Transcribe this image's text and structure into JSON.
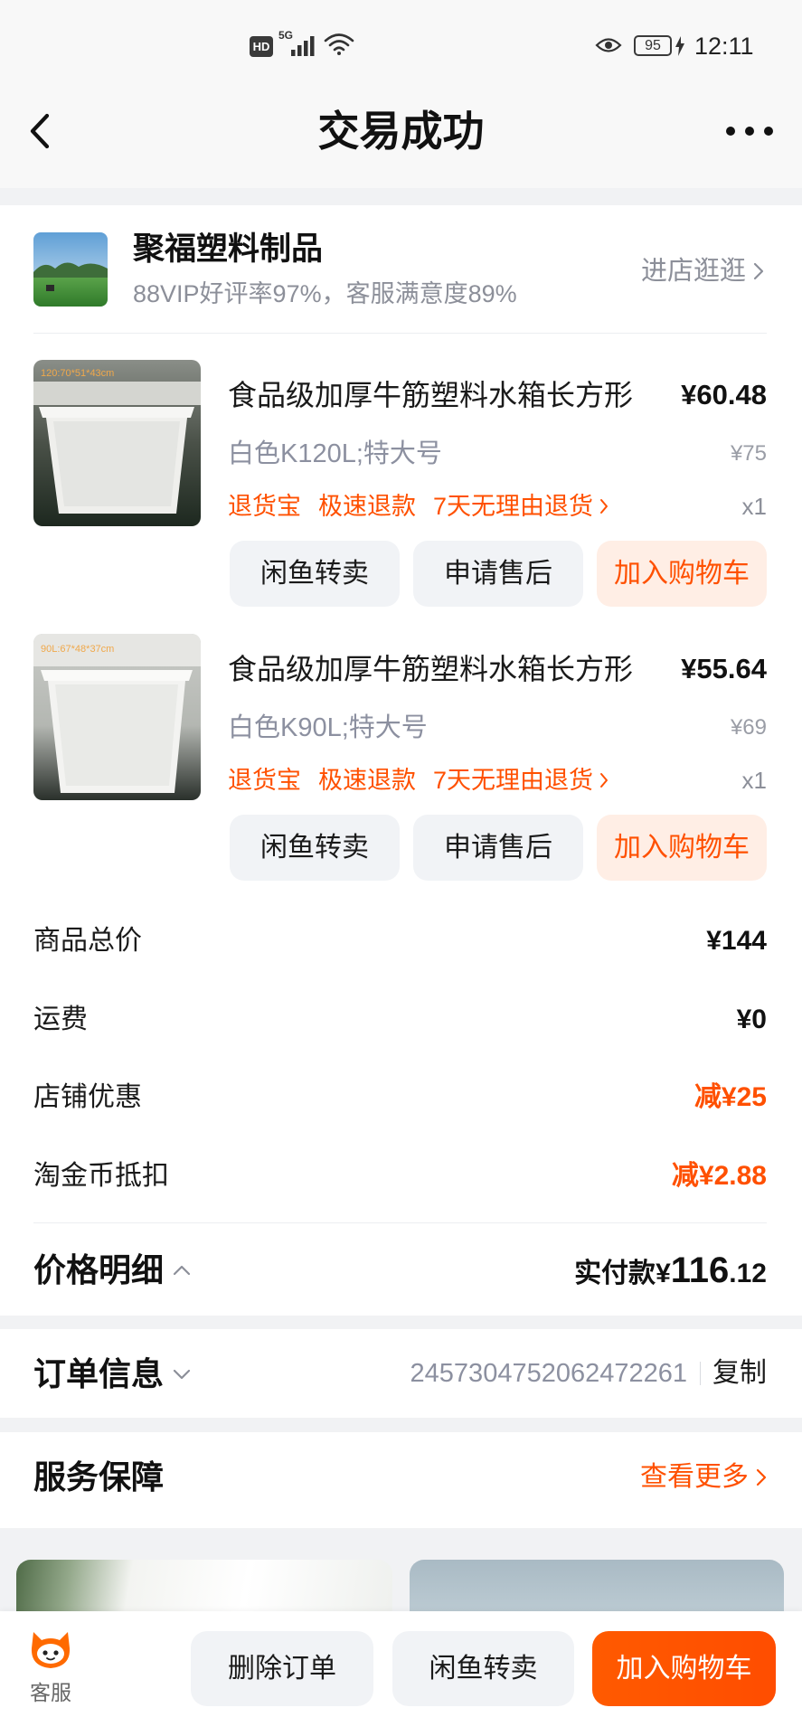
{
  "status_bar": {
    "hd": "HD",
    "network": "5G",
    "battery": "95",
    "time": "12:11"
  },
  "header": {
    "title": "交易成功",
    "back_icon": "chevron-left-icon",
    "more_icon": "more-dots-icon"
  },
  "shop": {
    "name": "聚福塑料制品",
    "subtitle": "88VIP好评率97%，客服满意度89%",
    "visit_label": "进店逛逛"
  },
  "items": [
    {
      "title": "食品级加厚牛筋塑料水箱长方形",
      "price": "¥60.48",
      "spec": "白色K120L;特大号",
      "original_price": "¥75",
      "tags": [
        "退货宝",
        "极速退款",
        "7天无理由退货"
      ],
      "quantity": "x1",
      "image_caption": "120:70*51*43cm",
      "actions": [
        "闲鱼转卖",
        "申请售后",
        "加入购物车"
      ]
    },
    {
      "title": "食品级加厚牛筋塑料水箱长方形",
      "price": "¥55.64",
      "spec": "白色K90L;特大号",
      "original_price": "¥69",
      "tags": [
        "退货宝",
        "极速退款",
        "7天无理由退货"
      ],
      "quantity": "x1",
      "image_caption": "90L:67*48*37cm",
      "actions": [
        "闲鱼转卖",
        "申请售后",
        "加入购物车"
      ]
    }
  ],
  "price_summary": {
    "rows": [
      {
        "label": "商品总价",
        "value": "¥144"
      },
      {
        "label": "运费",
        "value": "¥0"
      },
      {
        "label": "店铺优惠",
        "value": "减¥25"
      },
      {
        "label": "淘金币抵扣",
        "value": "减¥2.88"
      }
    ],
    "detail_label": "价格明细",
    "paid_label": "实付款",
    "paid_currency": "¥",
    "paid_integer": "116",
    "paid_decimal": ".12"
  },
  "order_info": {
    "label": "订单信息",
    "order_number": "2457304752062472261",
    "copy_label": "复制"
  },
  "service": {
    "label": "服务保障",
    "more_label": "查看更多"
  },
  "bottom_bar": {
    "service_label": "客服",
    "buttons": [
      "删除订单",
      "闲鱼转卖",
      "加入购物车"
    ]
  },
  "colors": {
    "accent": "#ff5000",
    "accent_light_bg": "#ffeee5",
    "page_bg": "#f1f2f4",
    "secondary_text": "#8c90a0",
    "button_bg": "#f1f3f6"
  }
}
